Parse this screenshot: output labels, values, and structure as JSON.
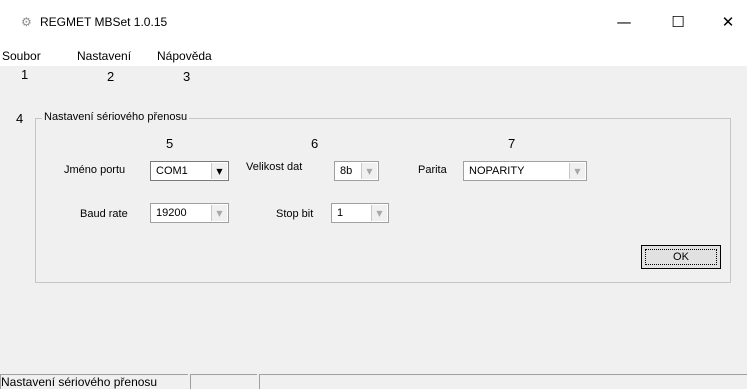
{
  "window": {
    "title": "REGMET MBSet 1.0.15",
    "icon": "gear-icon",
    "controls": {
      "minimize": "—",
      "maximize": "☐",
      "close": "✕"
    }
  },
  "menu": {
    "items": [
      "Soubor",
      "Nastavení",
      "Nápověda"
    ]
  },
  "annotations": [
    "1",
    "2",
    "3",
    "4",
    "5",
    "6",
    "7"
  ],
  "group": {
    "title": "Nastavení sériového přenosu"
  },
  "fields": {
    "port": {
      "label": "Jméno portu",
      "value": "COM1"
    },
    "data_size": {
      "label": "Velikost dat",
      "value": "8b"
    },
    "parity": {
      "label": "Parita",
      "value": "NOPARITY"
    },
    "baud": {
      "label": "Baud rate",
      "value": "19200"
    },
    "stop_bit": {
      "label": "Stop bit",
      "value": "1"
    }
  },
  "buttons": {
    "ok_label": "OK"
  },
  "status": {
    "text": "Nastavení sériového přenosu"
  },
  "colors": {
    "window_bg": "#f0f0f0",
    "titlebar_bg": "#ffffff",
    "desktop_bg": "#dde6f0"
  }
}
